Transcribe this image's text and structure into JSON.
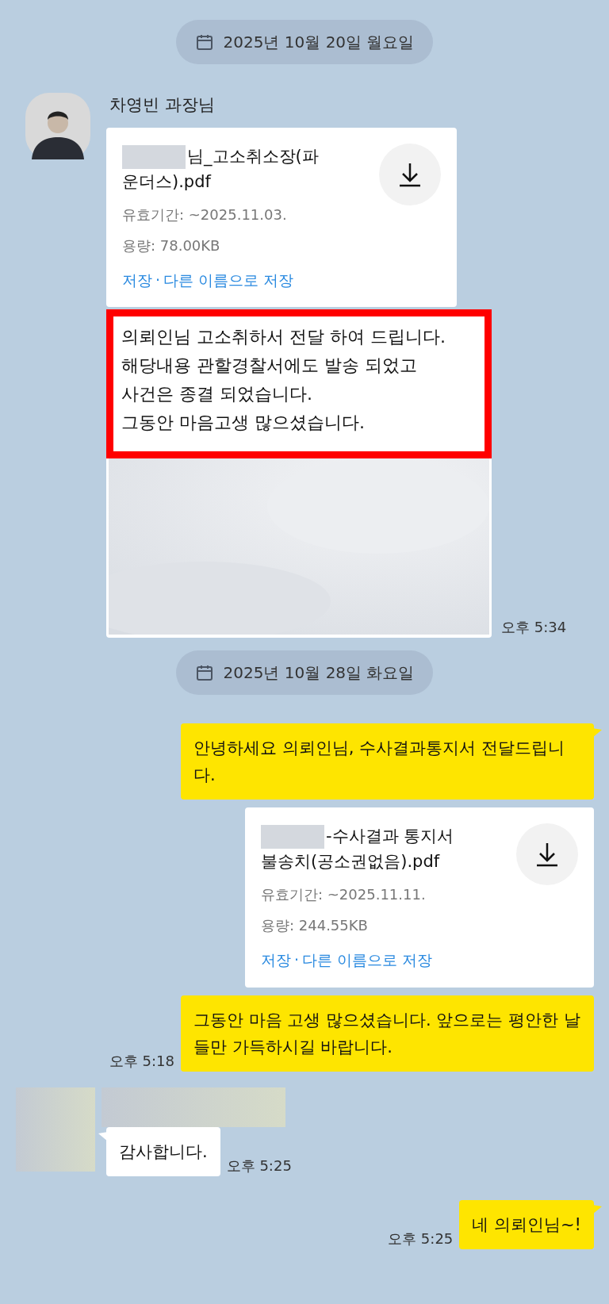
{
  "messages": [
    {
      "kind": "date",
      "text": "2025년 10월 20일 월요일"
    },
    {
      "kind": "file",
      "outgoing": false,
      "sender": "차영빈 과장님",
      "name_tail": "님_고소취소장(파운더스).pdf",
      "expiry": "유효기간: ~2025.11.03.",
      "size": "용량: 78.00KB",
      "save": "저장",
      "separator": "·",
      "save_as": "다른 이름으로 저장"
    },
    {
      "outgoing": false,
      "highlight_text": "의뢰인님 고소취하서 전달 하여 드립니다.\n해당내용 관할경찰서에도 발송 되었고\n사건은 종결 되었습니다.\n그동안 마음고생 많으셨습니다.",
      "time": "오후 5:34"
    },
    {
      "kind": "date",
      "text": "2025년 10월 28일 화요일"
    },
    {
      "kind": "text",
      "outgoing": true,
      "text": "안녕하세요 의뢰인님, 수사결과통지서 전달드립니다.",
      "tail": true
    },
    {
      "kind": "file",
      "outgoing": true,
      "name_tail": "-수사결과 통지서 불송치(공소권없음).pdf",
      "expiry": "유효기간: ~2025.11.11.",
      "size": "용량: 244.55KB",
      "save": "저장",
      "separator": "·",
      "save_as": "다른 이름으로 저장"
    },
    {
      "kind": "text",
      "outgoing": true,
      "text": "그동안 마음 고생 많으셨습니다. 앞으로는 평안한 날들만 가득하시길 바랍니다.",
      "time": "오후 5:18",
      "tail": false
    },
    {
      "kind": "text",
      "outgoing": false,
      "text": "감사합니다.",
      "time": "오후 5:25",
      "tail": true
    },
    {
      "kind": "text",
      "outgoing": true,
      "text": "네 의뢰인님~!",
      "time": "오후 5:25",
      "tail": true
    }
  ]
}
